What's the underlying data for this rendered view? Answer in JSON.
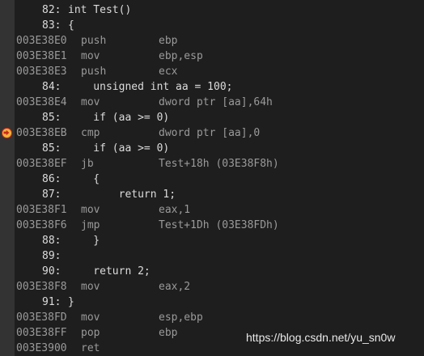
{
  "disassembly": {
    "lines": [
      {
        "kind": "src",
        "lno": "82:",
        "code": "int Test()"
      },
      {
        "kind": "src",
        "lno": "83:",
        "code": "{"
      },
      {
        "kind": "asm",
        "addr": "003E38E0",
        "mnem": "push",
        "ops": "ebp"
      },
      {
        "kind": "asm",
        "addr": "003E38E1",
        "mnem": "mov",
        "ops": "ebp,esp"
      },
      {
        "kind": "asm",
        "addr": "003E38E3",
        "mnem": "push",
        "ops": "ecx"
      },
      {
        "kind": "src",
        "lno": "84:",
        "code": "    unsigned int aa = 100;"
      },
      {
        "kind": "asm",
        "addr": "003E38E4",
        "mnem": "mov",
        "ops": "dword ptr [aa],64h"
      },
      {
        "kind": "src",
        "lno": "85:",
        "code": "    if (aa >= 0)"
      },
      {
        "kind": "asm",
        "addr": "003E38EB",
        "mnem": "cmp",
        "ops": "dword ptr [aa],0",
        "current": true
      },
      {
        "kind": "src",
        "lno": "85:",
        "code": "    if (aa >= 0)"
      },
      {
        "kind": "asm",
        "addr": "003E38EF",
        "mnem": "jb",
        "ops": "Test+18h (03E38F8h)"
      },
      {
        "kind": "src",
        "lno": "86:",
        "code": "    {"
      },
      {
        "kind": "src",
        "lno": "87:",
        "code": "        return 1;"
      },
      {
        "kind": "asm",
        "addr": "003E38F1",
        "mnem": "mov",
        "ops": "eax,1"
      },
      {
        "kind": "asm",
        "addr": "003E38F6",
        "mnem": "jmp",
        "ops": "Test+1Dh (03E38FDh)"
      },
      {
        "kind": "src",
        "lno": "88:",
        "code": "    }"
      },
      {
        "kind": "src",
        "lno": "89:",
        "code": ""
      },
      {
        "kind": "src",
        "lno": "90:",
        "code": "    return 2;"
      },
      {
        "kind": "asm",
        "addr": "003E38F8",
        "mnem": "mov",
        "ops": "eax,2"
      },
      {
        "kind": "src",
        "lno": "91:",
        "code": "}"
      },
      {
        "kind": "asm",
        "addr": "003E38FD",
        "mnem": "mov",
        "ops": "esp,ebp"
      },
      {
        "kind": "asm",
        "addr": "003E38FF",
        "mnem": "pop",
        "ops": "ebp"
      },
      {
        "kind": "asm",
        "addr": "003E3900",
        "mnem": "ret",
        "ops": ""
      }
    ]
  },
  "watermark": "https://blog.csdn.net/yu_sn0w",
  "colors": {
    "background": "#1e1e1e",
    "gutter": "#333333",
    "source_text": "#dcdcdc",
    "asm_text": "#9a9a9a",
    "current_instruction_marker": "#f2b33a"
  },
  "icons": {
    "current_instruction": "instruction-pointer-arrow-icon"
  }
}
